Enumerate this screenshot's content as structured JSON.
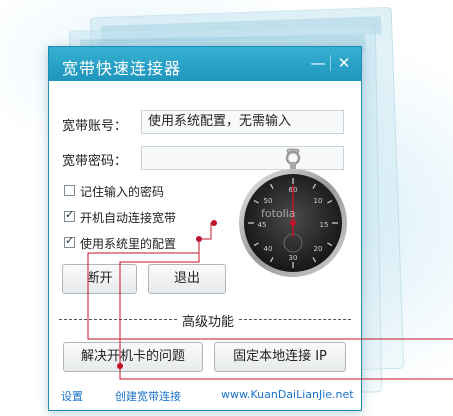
{
  "window": {
    "title": "宽带快速连接器",
    "minimize_glyph": "—",
    "close_glyph": "✕"
  },
  "form": {
    "account_label": "宽带账号：",
    "account_value": "使用系统配置，无需输入",
    "password_label": "宽带密码：",
    "password_value": ""
  },
  "options": [
    {
      "label": "记住输入的密码",
      "checked": false
    },
    {
      "label": "开机自动连接宽带",
      "checked": true
    },
    {
      "label": "使用系统里的配置",
      "checked": true
    }
  ],
  "actions": {
    "disconnect_label": "断开",
    "exit_label": "退出"
  },
  "advanced": {
    "section_label": "高级功能",
    "fix_boot_label": "解决开机卡的问题",
    "fixed_ip_label": "固定本地连接 IP"
  },
  "footer": {
    "settings_link": "设置",
    "create_link": "创建宽带连接",
    "website": "www.KuanDaiLianJie.net"
  },
  "watermark": "fotolia",
  "colors": {
    "title_bar": "#2aa3ca",
    "accent_red": "#c0142a",
    "link": "#1a73c8"
  }
}
